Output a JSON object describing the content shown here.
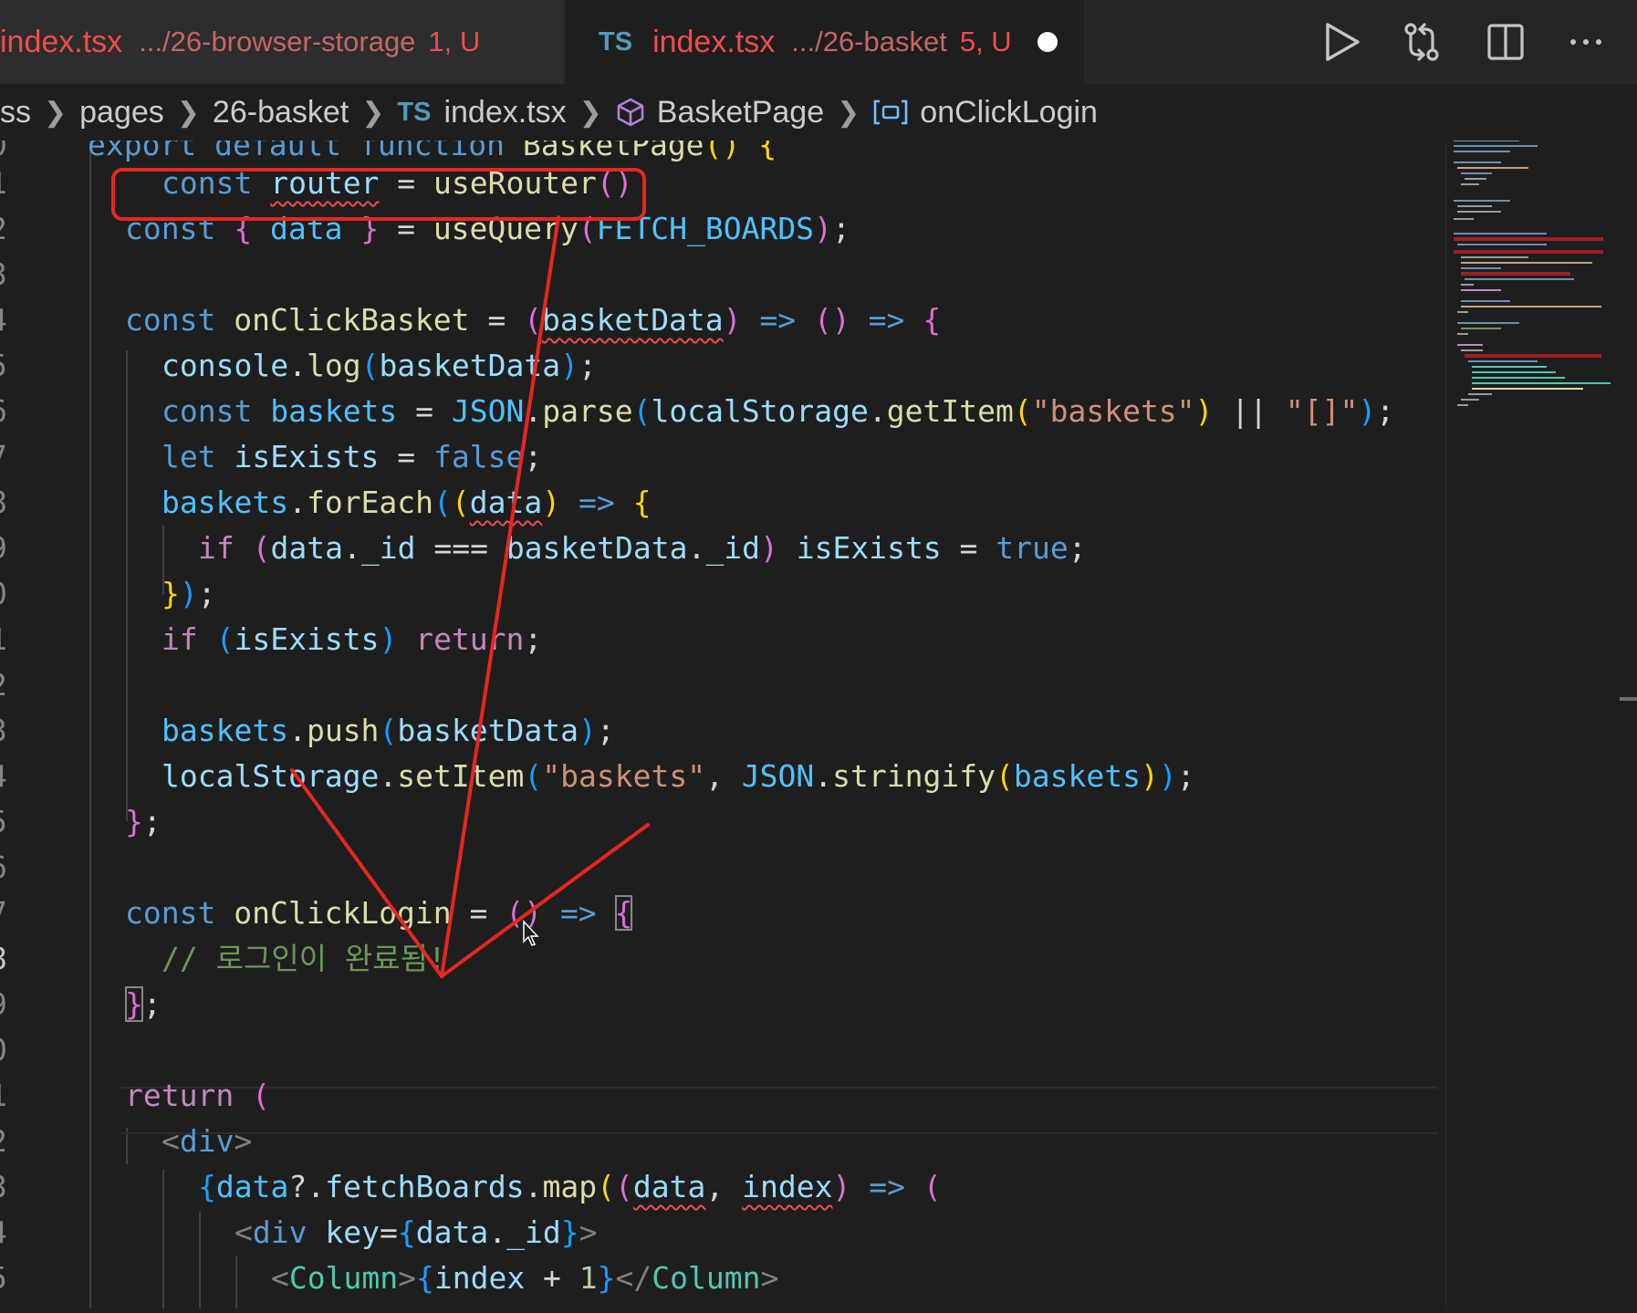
{
  "tabs": [
    {
      "type_label": "",
      "filename": "index.tsx",
      "path": ".../26-browser-storage",
      "badge": "1, U",
      "modified": false,
      "active": false
    },
    {
      "type_label": "TS",
      "filename": "index.tsx",
      "path": ".../26-basket",
      "badge": "5, U",
      "modified": true,
      "active": true
    }
  ],
  "toolbar": {
    "run": "play-icon",
    "compare": "git-compare-icon",
    "split": "split-editor-icon",
    "more": "more-actions-icon"
  },
  "breadcrumb": {
    "items": [
      "ss",
      "pages",
      "26-basket",
      "index.tsx",
      "BasketPage",
      "onClickLogin"
    ],
    "ts_label": "TS"
  },
  "code": {
    "lines": [
      {
        "num": "0",
        "text": "export default function BasketPage() {"
      },
      {
        "num": "1",
        "text": "const router = useRouter()"
      },
      {
        "num": "2",
        "text": "const { data } = useQuery(FETCH_BOARDS);"
      },
      {
        "num": "3",
        "text": ""
      },
      {
        "num": "4",
        "text": "const onClickBasket = (basketData) => () => {"
      },
      {
        "num": "5",
        "text": "console.log(basketData);"
      },
      {
        "num": "6",
        "text": "const baskets = JSON.parse(localStorage.getItem(\"baskets\") || \"[]\");"
      },
      {
        "num": "7",
        "text": "let isExists = false;"
      },
      {
        "num": "8",
        "text": "baskets.forEach((data) => {"
      },
      {
        "num": "9",
        "text": "if (data._id === basketData._id) isExists = true;"
      },
      {
        "num": "0",
        "text": "});"
      },
      {
        "num": "1",
        "text": "if (isExists) return;"
      },
      {
        "num": "2",
        "text": ""
      },
      {
        "num": "3",
        "text": "baskets.push(basketData);"
      },
      {
        "num": "4",
        "text": "localStorage.setItem(\"baskets\", JSON.stringify(baskets));"
      },
      {
        "num": "5",
        "text": "};"
      },
      {
        "num": "6",
        "text": ""
      },
      {
        "num": "7",
        "text": "const onClickLogin = () => {"
      },
      {
        "num": "8",
        "text": "// 로그인이 완료됨!"
      },
      {
        "num": "9",
        "text": "};"
      },
      {
        "num": "0",
        "text": ""
      },
      {
        "num": "1",
        "text": "return ("
      },
      {
        "num": "2",
        "text": "<div>"
      },
      {
        "num": "3",
        "text": "{data?.fetchBoards.map((data, index) => ("
      },
      {
        "num": "4",
        "text": "<div key={data._id}>"
      },
      {
        "num": "5",
        "text": "<Column>{index + 1}</Column>"
      }
    ]
  },
  "colors": {
    "editor_bg": "#1e1e1e",
    "annotation": "#e8261f",
    "error": "#f14c4c",
    "keyword": "#569cd6",
    "function": "#dcdcaa",
    "string": "#ce9178",
    "comment": "#6a9955"
  }
}
